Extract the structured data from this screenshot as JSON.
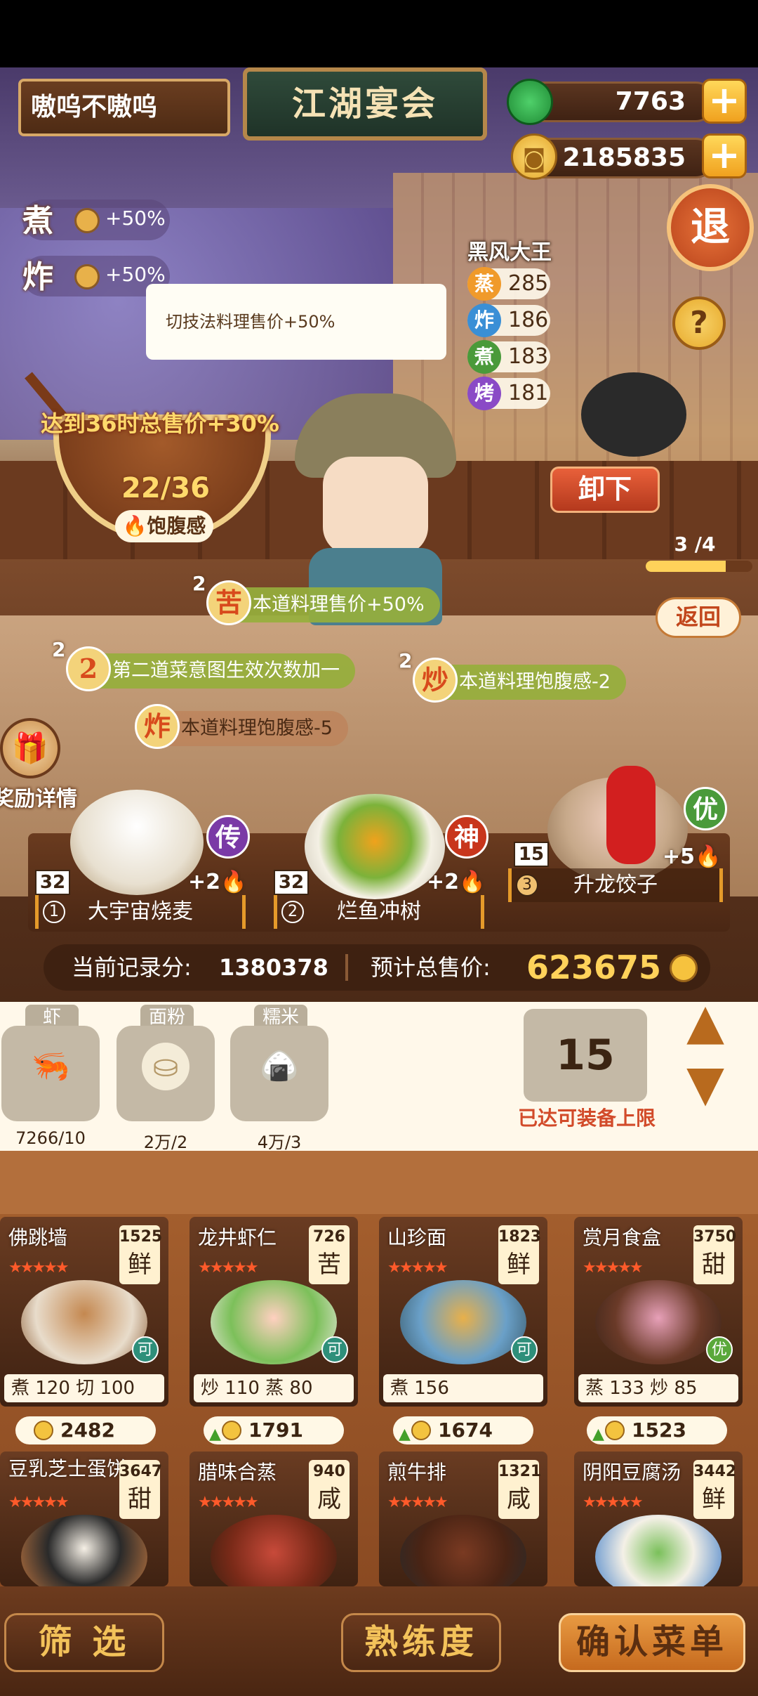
{
  "header": {
    "username": "嗷呜不嗷呜",
    "title": "江湖宴会",
    "jade": "7763",
    "coins": "2185835",
    "exit_label": "退",
    "help_label": "?"
  },
  "buffs": [
    {
      "skill": "煮",
      "value": "+50%"
    },
    {
      "skill": "炸",
      "value": "+50%"
    }
  ],
  "tooltip": "切技法料理售价+50%",
  "opponent": {
    "name": "黑风大王",
    "stats": [
      {
        "skill": "蒸",
        "value": "285",
        "color": "#f09a2a"
      },
      {
        "skill": "炸",
        "value": "186",
        "color": "#3a8fd6"
      },
      {
        "skill": "煮",
        "value": "183",
        "color": "#4a9a3a"
      },
      {
        "skill": "烤",
        "value": "181",
        "color": "#8a4ac6"
      }
    ]
  },
  "bowl": {
    "goal": "达到36时总售价+30%",
    "progress": "22/36",
    "label": "饱腹感"
  },
  "controls": {
    "unload": "卸下",
    "page": "3 /4",
    "page_fraction": 0.75,
    "back": "返回"
  },
  "effects": [
    {
      "count": "2",
      "badge": "苦",
      "text": "本道料理售价+50%"
    },
    {
      "count": "2",
      "badge": "2",
      "text": "第二道菜意图生效次数加一"
    },
    {
      "count": "2",
      "badge": "炒",
      "text": "本道料理饱腹感-2"
    },
    {
      "count": "",
      "badge": "炸",
      "text": "本道料理饱腹感-5"
    }
  ],
  "reward_label": "奖励详情",
  "slots": [
    {
      "index": "1",
      "name": "大宇宙烧麦",
      "level": "32",
      "grade": "传",
      "grade_color": "#7a3aa6",
      "bonus": "+2"
    },
    {
      "index": "2",
      "name": "烂鱼冲树",
      "level": "32",
      "grade": "神",
      "grade_color": "#c8361c",
      "bonus": "+2"
    },
    {
      "index": "3",
      "name": "升龙饺子",
      "level": "15",
      "grade": "优",
      "grade_color": "#4a9a3a",
      "bonus": "+5"
    }
  ],
  "score": {
    "record_label": "当前记录分:",
    "record": "1380378",
    "price_label": "预计总售价:",
    "price": "623675"
  },
  "ingredients": [
    {
      "name": "虾",
      "count": "7266/10",
      "icon": "shrimp-icon",
      "emoji": "🦐"
    },
    {
      "name": "面粉",
      "count": "2万/2",
      "icon": "flour-icon",
      "emoji": "⛀"
    },
    {
      "name": "糯米",
      "count": "4万/3",
      "icon": "rice-icon",
      "emoji": "🍙"
    }
  ],
  "capacity": {
    "value": "15",
    "label": "已达可装备上限"
  },
  "menu": [
    {
      "name": "佛跳墙",
      "cost": "1525",
      "flavor": "鲜",
      "stars": "★★★★★",
      "skills": "煮 120  切 100",
      "price": "2482",
      "up": false,
      "tag": "可"
    },
    {
      "name": "龙井虾仁",
      "cost": "726",
      "flavor": "苦",
      "stars": "★★★★★",
      "skills": "炒 110  蒸 80",
      "price": "1791",
      "up": true,
      "tag": "可"
    },
    {
      "name": "山珍面",
      "cost": "1823",
      "flavor": "鲜",
      "stars": "★★★★★",
      "skills": "煮 156",
      "price": "1674",
      "up": true,
      "tag": "可"
    },
    {
      "name": "赏月食盒",
      "cost": "3750",
      "flavor": "甜",
      "stars": "★★★★★",
      "skills": "蒸 133  炒 85",
      "price": "1523",
      "up": true,
      "tag": "优"
    },
    {
      "name": "豆乳芝士蛋饼",
      "cost": "3647",
      "flavor": "甜",
      "stars": "★★★★★",
      "skills": "",
      "price": "",
      "up": false,
      "tag": ""
    },
    {
      "name": "腊味合蒸",
      "cost": "940",
      "flavor": "咸",
      "stars": "★★★★★",
      "skills": "",
      "price": "",
      "up": false,
      "tag": ""
    },
    {
      "name": "煎牛排",
      "cost": "1321",
      "flavor": "咸",
      "stars": "★★★★★",
      "skills": "",
      "price": "",
      "up": false,
      "tag": ""
    },
    {
      "name": "阴阳豆腐汤",
      "cost": "3442",
      "flavor": "鲜",
      "stars": "★★★★★",
      "skills": "",
      "price": "",
      "up": false,
      "tag": ""
    }
  ],
  "bottom": {
    "filter": "筛 选",
    "proficiency": "熟练度",
    "confirm": "确认菜单"
  }
}
